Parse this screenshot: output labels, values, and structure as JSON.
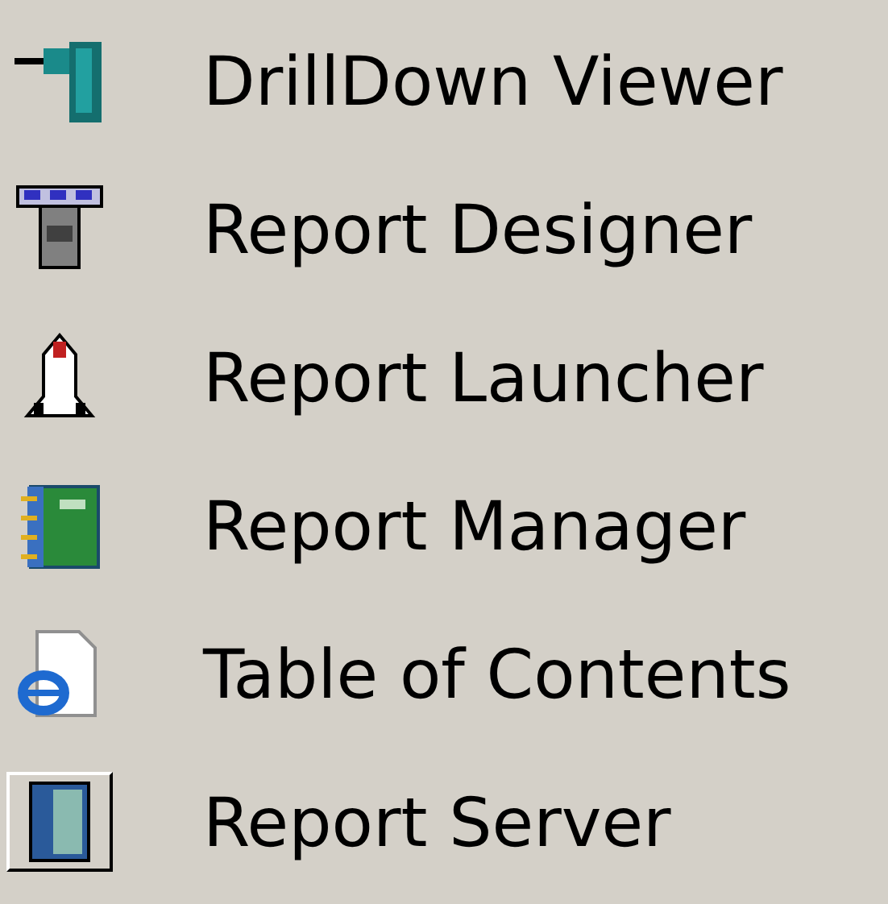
{
  "menu": {
    "items": [
      {
        "label": "DrillDown Viewer",
        "selected": false
      },
      {
        "label": "Report Designer",
        "selected": false
      },
      {
        "label": "Report Launcher",
        "selected": false
      },
      {
        "label": "Report Manager",
        "selected": false
      },
      {
        "label": "Table of Contents",
        "selected": false
      },
      {
        "label": "Report Server",
        "selected": true
      }
    ]
  }
}
